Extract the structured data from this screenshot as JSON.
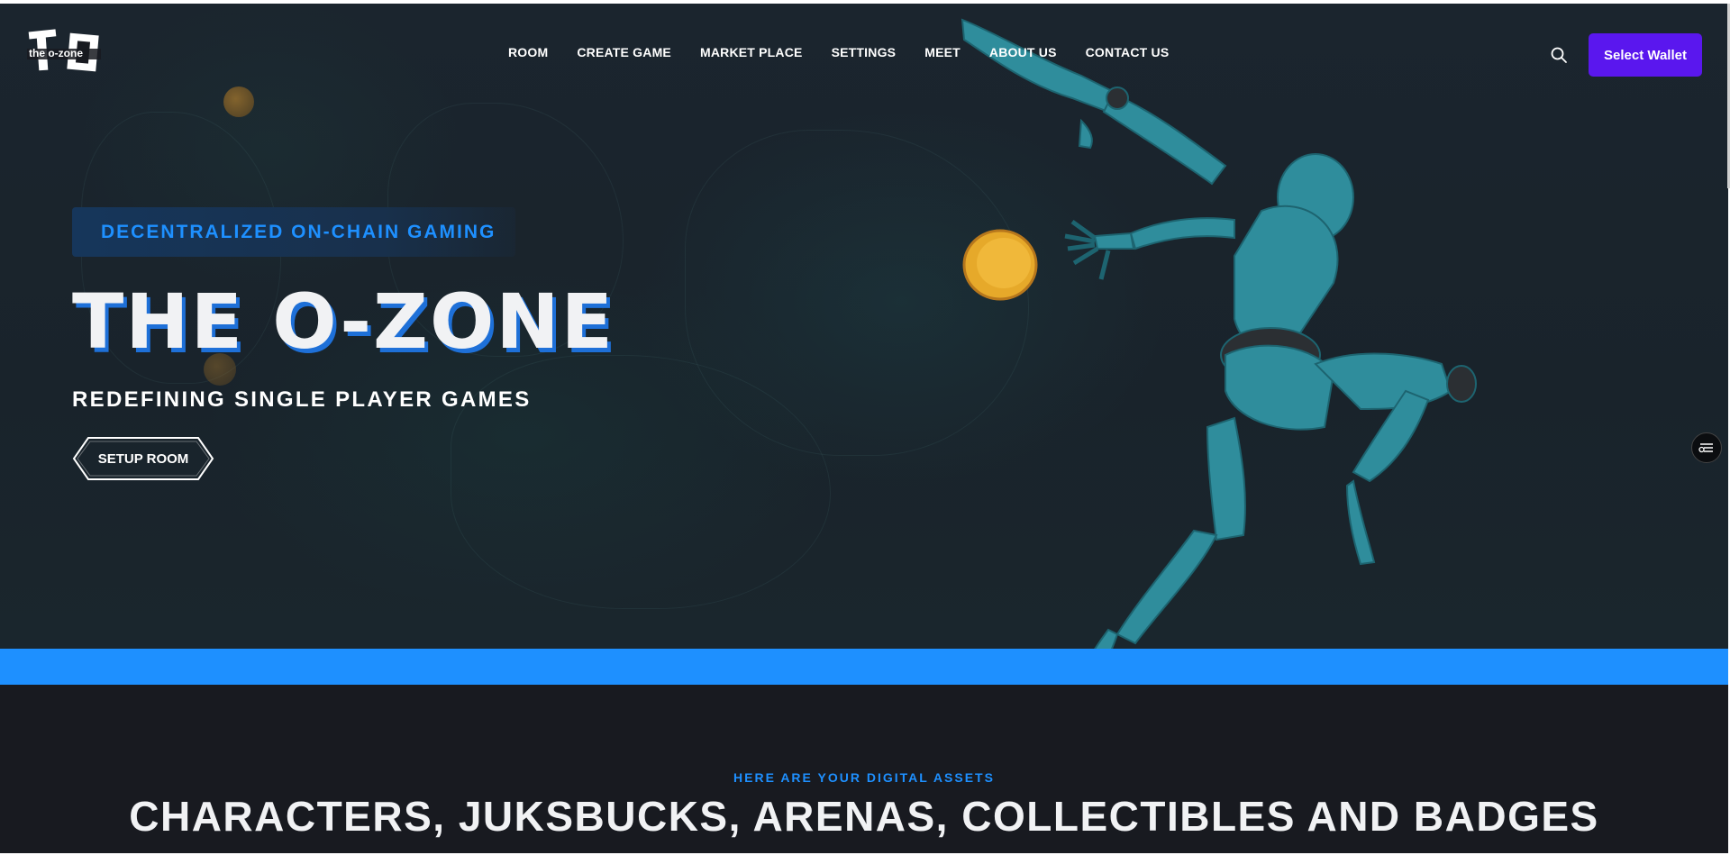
{
  "brand": {
    "logo_text": "the o-zone",
    "logo_initials": "TO"
  },
  "nav": {
    "items": [
      {
        "label": "ROOM"
      },
      {
        "label": "CREATE GAME"
      },
      {
        "label": "MARKET PLACE"
      },
      {
        "label": "SETTINGS"
      },
      {
        "label": "MEET"
      },
      {
        "label": "ABOUT US"
      },
      {
        "label": "CONTACT US"
      }
    ],
    "search_icon": "search-icon",
    "wallet_label": "Select Wallet"
  },
  "hero": {
    "badge": "DECENTRALIZED ON-CHAIN GAMING",
    "title": "THE O-ZONE",
    "subtitle": "REDEFINING SINGLE PLAYER GAMES",
    "cta_label": "SETUP ROOM"
  },
  "section": {
    "eyebrow": "HERE ARE YOUR DIGITAL ASSETS",
    "title": "CHARACTERS, JUKSBUCKS, ARENAS, COLLECTIBLES AND BADGES"
  },
  "colors": {
    "accent_blue": "#1e90ff",
    "wallet_purple": "#5a17ee",
    "figure_teal": "#2f8d9c",
    "coin_gold": "#e6a92a",
    "page_bg": "#181a20"
  }
}
